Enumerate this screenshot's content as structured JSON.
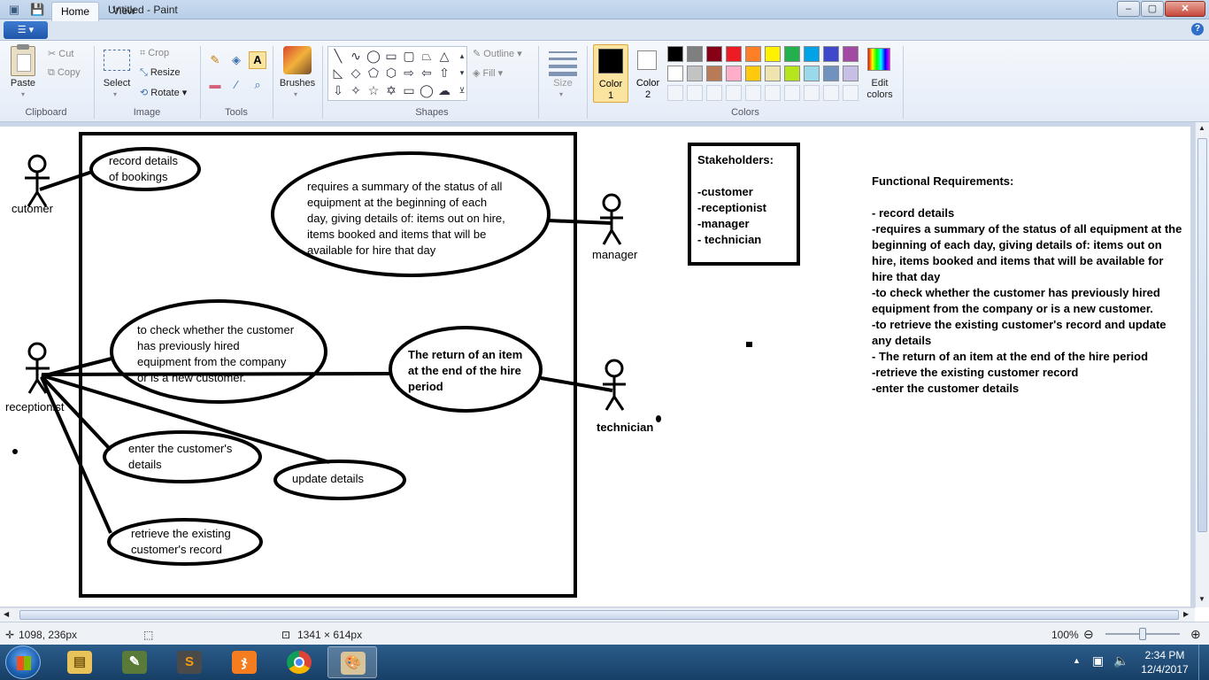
{
  "window": {
    "title": "Untitled - Paint",
    "controls": [
      "–",
      "▢",
      "✕"
    ]
  },
  "quick_access": {
    "save": "💾",
    "undo": "↶",
    "redo": "↷",
    "customize": "▾"
  },
  "tabs": {
    "file": "☰ ▾",
    "home": "Home",
    "view": "View"
  },
  "help": "?",
  "ribbon": {
    "clipboard": {
      "paste": "Paste",
      "cut": "Cut",
      "copy": "Copy",
      "label": "Clipboard"
    },
    "image": {
      "select": "Select",
      "crop": "Crop",
      "resize": "Resize",
      "rotate": "Rotate",
      "label": "Image"
    },
    "tools": {
      "label": "Tools",
      "text_tool": "A"
    },
    "brushes": {
      "label": "Brushes"
    },
    "shapes": {
      "label": "Shapes",
      "outline": "Outline",
      "fill": "Fill"
    },
    "size": {
      "label": "Size"
    },
    "colors": {
      "color1": "Color\n1",
      "color2": "Color\n2",
      "edit": "Edit\ncolors",
      "label": "Colors",
      "palette_row1": [
        "#000000",
        "#7f7f7f",
        "#880015",
        "#ed1c24",
        "#ff7f27",
        "#fff200",
        "#22b14c",
        "#00a2e8",
        "#3f48cc",
        "#a349a4"
      ],
      "palette_row2": [
        "#ffffff",
        "#c3c3c3",
        "#b97a57",
        "#ffaec9",
        "#ffc90e",
        "#efe4b0",
        "#b5e61d",
        "#99d9ea",
        "#7092be",
        "#c8bfe7"
      ],
      "color1_value": "#000000",
      "color2_value": "#ffffff"
    }
  },
  "diagram": {
    "actors": {
      "customer": "cutomer",
      "manager": "manager",
      "receptionist": "receptionist",
      "technician": "technician"
    },
    "use_cases": {
      "record": "record details\nof bookings",
      "summary": "requires a summary of the status of all\nequipment at the beginning of each\nday, giving details of: items out on hire,\nitems booked and items that will be\navailable for hire that day",
      "check": "to check whether the customer\nhas previously hired\nequipment from the company\nor is a new customer.",
      "return": "The return of an item\nat the end of the hire\nperiod",
      "enter": "enter the customer's\ndetails",
      "update": "update details",
      "retrieve": "retrieve the existing\ncustomer's record"
    },
    "stakeholders": "Stakeholders:\n\n-customer\n-receptionist\n-manager\n- technician",
    "requirements": {
      "title": "Functional Requirements:",
      "items": [
        "- record details",
        "-requires a summary of the status of all equipment at the beginning of each day, giving details of: items out on hire, items booked and items that will be available for hire that day",
        "-to check whether the customer has previously hired equipment from the company or is a new customer.",
        "-to retrieve the existing customer's record and update any details",
        "- The return of an item at the end of the hire period",
        "-retrieve the existing customer record",
        "-enter the customer details"
      ]
    }
  },
  "status": {
    "cursor": "1098, 236px",
    "canvas_size": "1341 × 614px",
    "zoom": "100%",
    "zoom_fraction": 0.5
  },
  "taskbar": {
    "time": "2:34 PM",
    "date": "12/4/2017"
  }
}
